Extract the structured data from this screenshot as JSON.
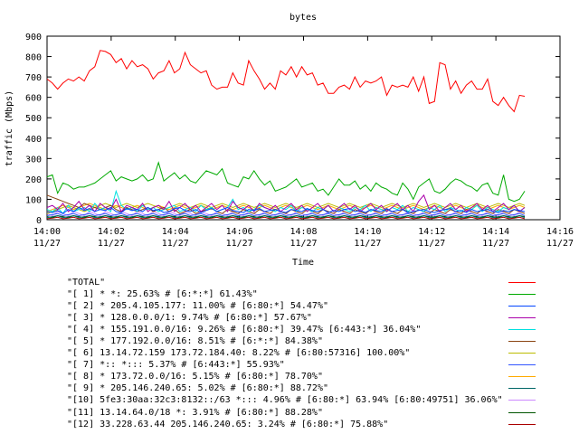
{
  "chart_data": {
    "type": "line",
    "title": "bytes",
    "xlabel": "Time",
    "ylabel": "traffic (Mbps)",
    "ylim": [
      0,
      900
    ],
    "xlim": [
      "14:00",
      "14:16"
    ],
    "y_ticks": [
      "0",
      "100",
      "200",
      "300",
      "400",
      "500",
      "600",
      "700",
      "800",
      "900"
    ],
    "x_ticks": [
      {
        "time": "14:00",
        "date": "11/27"
      },
      {
        "time": "14:02",
        "date": "11/27"
      },
      {
        "time": "14:04",
        "date": "11/27"
      },
      {
        "time": "14:06",
        "date": "11/27"
      },
      {
        "time": "14:08",
        "date": "11/27"
      },
      {
        "time": "14:10",
        "date": "11/27"
      },
      {
        "time": "14:12",
        "date": "11/27"
      },
      {
        "time": "14:14",
        "date": "11/27"
      },
      {
        "time": "14:16",
        "date": "11/27"
      }
    ],
    "grid": false,
    "legend_position": "bottom",
    "series": [
      {
        "name": "\"TOTAL\"",
        "color": "#ff0000",
        "values": [
          690,
          670,
          640,
          670,
          690,
          680,
          700,
          680,
          730,
          750,
          830,
          825,
          810,
          770,
          790,
          740,
          780,
          750,
          760,
          740,
          690,
          720,
          730,
          780,
          720,
          740,
          820,
          760,
          740,
          720,
          730,
          660,
          640,
          650,
          650,
          720,
          670,
          660,
          780,
          730,
          690,
          640,
          670,
          640,
          730,
          710,
          750,
          700,
          750,
          710,
          720,
          660,
          670,
          620,
          620,
          650,
          660,
          640,
          700,
          650,
          680,
          670,
          680,
          700,
          610,
          660,
          650,
          660,
          650,
          700,
          630,
          700,
          570,
          580,
          770,
          760,
          640,
          680,
          620,
          660,
          680,
          640,
          640,
          690,
          580,
          560,
          600,
          560,
          530,
          610,
          605
        ]
      },
      {
        "name": "\"[ 1] * *: 25.63% # [6:*:*] 61.43%\"",
        "color": "#00aa00",
        "values": [
          210,
          220,
          130,
          180,
          170,
          150,
          160,
          160,
          170,
          180,
          200,
          220,
          240,
          190,
          210,
          200,
          190,
          200,
          220,
          190,
          200,
          280,
          190,
          210,
          230,
          200,
          220,
          190,
          180,
          210,
          240,
          230,
          220,
          250,
          180,
          170,
          160,
          210,
          200,
          240,
          200,
          170,
          190,
          140,
          150,
          160,
          180,
          200,
          160,
          170,
          180,
          140,
          150,
          120,
          160,
          200,
          170,
          170,
          190,
          150,
          170,
          140,
          180,
          160,
          150,
          130,
          120,
          180,
          150,
          100,
          160,
          180,
          200,
          140,
          130,
          150,
          180,
          200,
          190,
          170,
          160,
          140,
          170,
          180,
          130,
          120,
          220,
          100,
          90,
          100,
          140
        ]
      },
      {
        "name": "\"[ 2] * 205.4.105.177: 11.00% # [6:80:*] 54.47%\"",
        "color": "#0044ff",
        "values": [
          40,
          35,
          45,
          30,
          50,
          40,
          60,
          45,
          55,
          40,
          50,
          45,
          60,
          40,
          35,
          55,
          45,
          50,
          40,
          60,
          45,
          50,
          35,
          40,
          55,
          60,
          45,
          40,
          50,
          35,
          45,
          55,
          40,
          50,
          60,
          45,
          40,
          35,
          50,
          45,
          55,
          40,
          45,
          50,
          40,
          35,
          50,
          45,
          40,
          55,
          45,
          40,
          50,
          35,
          45,
          40,
          50,
          55,
          40,
          45,
          35,
          50,
          45,
          40,
          55,
          40,
          45,
          50,
          35,
          40,
          45,
          50,
          40,
          35,
          45,
          50,
          55,
          40,
          45,
          35,
          50,
          40,
          45,
          50,
          40,
          35,
          45,
          40,
          50,
          45,
          40
        ]
      },
      {
        "name": "\"[ 3] * 128.0.0.0/1: 9.74% # [6:80:*] 57.67%\"",
        "color": "#aa00aa",
        "values": [
          60,
          70,
          50,
          80,
          40,
          60,
          90,
          50,
          70,
          40,
          80,
          60,
          50,
          100,
          40,
          70,
          60,
          50,
          80,
          40,
          60,
          70,
          50,
          90,
          40,
          60,
          80,
          50,
          70,
          40,
          60,
          80,
          50,
          70,
          40,
          90,
          60,
          50,
          70,
          40,
          80,
          60,
          50,
          70,
          40,
          60,
          80,
          50,
          70,
          40,
          60,
          80,
          50,
          70,
          40,
          60,
          80,
          50,
          70,
          40,
          60,
          80,
          50,
          70,
          40,
          60,
          80,
          50,
          70,
          40,
          90,
          120,
          50,
          70,
          40,
          60,
          80,
          50,
          70,
          40,
          60,
          80,
          50,
          70,
          40,
          60,
          80,
          50,
          70,
          40,
          60
        ]
      },
      {
        "name": "\"[ 4] * 155.191.0.0/16: 9.26% # [6:80:*] 39.47% [6:443:*] 36.04%\"",
        "color": "#00e0e0",
        "values": [
          50,
          40,
          60,
          30,
          70,
          40,
          50,
          60,
          40,
          80,
          50,
          60,
          40,
          140,
          70,
          50,
          60,
          40,
          70,
          50,
          60,
          40,
          50,
          60,
          70,
          40,
          50,
          60,
          40,
          70,
          50,
          60,
          40,
          50,
          60,
          100,
          50,
          60,
          40,
          50,
          70,
          60,
          50,
          40,
          60,
          50,
          70,
          40,
          60,
          50,
          40,
          60,
          50,
          70,
          40,
          60,
          50,
          40,
          60,
          50,
          70,
          40,
          60,
          50,
          40,
          60,
          50,
          70,
          40,
          60,
          50,
          40,
          60,
          50,
          70,
          40,
          60,
          50,
          40,
          60,
          50,
          70,
          40,
          60,
          50,
          40,
          60,
          50,
          70,
          40,
          60
        ]
      },
      {
        "name": "\"[ 5] * 177.192.0.0/16: 8.51% # [6:*:*] 84.38%\"",
        "color": "#8b4513",
        "values": [
          120,
          110,
          100,
          90,
          80,
          70,
          60,
          80,
          70,
          60,
          50,
          60,
          70,
          50,
          40,
          60,
          50,
          40,
          50,
          60,
          40,
          50,
          60,
          40,
          50,
          30,
          40,
          50,
          30,
          40,
          50,
          60,
          40,
          30,
          50,
          40,
          30,
          50,
          40,
          30,
          50,
          40,
          30,
          50,
          40,
          30,
          50,
          40,
          30,
          50,
          40,
          30,
          50,
          40,
          30,
          50,
          40,
          30,
          50,
          40,
          30,
          50,
          40,
          30,
          50,
          40,
          30,
          50,
          40,
          30,
          50,
          40,
          30,
          50,
          40,
          30,
          50,
          40,
          30,
          50,
          40,
          30,
          50,
          40,
          30,
          50,
          40,
          30,
          50,
          40,
          30
        ]
      },
      {
        "name": "\"[ 6] 13.14.72.159 173.72.184.40: 8.22% # [6:80:57316] 100.00%\"",
        "color": "#bbbb00",
        "values": [
          30,
          40,
          50,
          60,
          70,
          60,
          50,
          40,
          50,
          60,
          70,
          80,
          70,
          60,
          70,
          80,
          70,
          60,
          70,
          80,
          70,
          60,
          50,
          60,
          70,
          80,
          70,
          60,
          70,
          80,
          70,
          60,
          70,
          80,
          70,
          60,
          70,
          80,
          70,
          60,
          70,
          80,
          70,
          60,
          70,
          80,
          70,
          60,
          70,
          80,
          70,
          60,
          70,
          80,
          70,
          60,
          70,
          80,
          70,
          60,
          70,
          80,
          70,
          60,
          70,
          80,
          70,
          60,
          70,
          80,
          70,
          60,
          70,
          80,
          70,
          60,
          70,
          80,
          70,
          60,
          70,
          80,
          70,
          60,
          70,
          80,
          70,
          60,
          70,
          80,
          70
        ]
      },
      {
        "name": "\"[ 7] *:: *::: 5.37% # [6:443:*] 55.93%\"",
        "color": "#3355ff",
        "values": [
          20,
          25,
          30,
          20,
          25,
          30,
          20,
          25,
          30,
          20,
          25,
          30,
          20,
          25,
          30,
          20,
          25,
          30,
          20,
          25,
          30,
          20,
          25,
          30,
          20,
          25,
          30,
          20,
          25,
          30,
          20,
          25,
          30,
          20,
          25,
          30,
          20,
          25,
          30,
          20,
          25,
          30,
          20,
          25,
          30,
          20,
          25,
          30,
          20,
          25,
          30,
          20,
          25,
          30,
          20,
          25,
          30,
          20,
          25,
          30,
          20,
          25,
          30,
          20,
          25,
          30,
          20,
          25,
          30,
          20,
          25,
          30,
          20,
          25,
          30,
          20,
          25,
          30,
          20,
          25,
          30,
          20,
          25,
          30,
          20,
          25,
          30,
          20,
          25,
          30,
          20
        ]
      },
      {
        "name": "\"[ 8] * 173.72.0.0/16: 5.15% # [6:80:*] 78.70%\"",
        "color": "#ffaa00",
        "values": [
          40,
          50,
          60,
          70,
          60,
          50,
          60,
          70,
          80,
          70,
          60,
          50,
          60,
          70,
          60,
          50,
          60,
          70,
          60,
          50,
          60,
          70,
          60,
          50,
          60,
          70,
          60,
          50,
          60,
          70,
          60,
          50,
          60,
          70,
          60,
          50,
          60,
          70,
          60,
          50,
          60,
          70,
          60,
          50,
          60,
          70,
          60,
          50,
          60,
          70,
          60,
          50,
          60,
          70,
          60,
          50,
          60,
          70,
          60,
          50,
          60,
          70,
          60,
          50,
          60,
          70,
          60,
          50,
          60,
          70,
          60,
          50,
          60,
          70,
          60,
          50,
          60,
          70,
          60,
          50,
          60,
          70,
          60,
          50,
          60,
          70,
          60,
          50,
          60,
          70,
          60
        ]
      },
      {
        "name": "\"[ 9] * 205.146.240.65: 5.02% # [6:80:*] 88.72%\"",
        "color": "#006666",
        "values": [
          10,
          15,
          20,
          10,
          15,
          20,
          10,
          15,
          20,
          10,
          15,
          20,
          10,
          15,
          20,
          10,
          15,
          20,
          10,
          15,
          20,
          10,
          15,
          20,
          10,
          15,
          20,
          10,
          15,
          20,
          10,
          15,
          20,
          10,
          15,
          20,
          10,
          15,
          20,
          10,
          15,
          20,
          10,
          15,
          20,
          10,
          15,
          20,
          10,
          15,
          20,
          10,
          15,
          20,
          10,
          15,
          20,
          10,
          15,
          20,
          10,
          15,
          20,
          10,
          15,
          20,
          10,
          15,
          20,
          10,
          15,
          20,
          10,
          15,
          20,
          10,
          15,
          20,
          10,
          15,
          20,
          10,
          15,
          20,
          10,
          15,
          20,
          10,
          15,
          20,
          10
        ]
      },
      {
        "name": "\"[10] 5fe3:30aa:32c3:8132::/63 *::: 4.96% # [6:80:*] 63.94% [6:80:49751] 36.06%\"",
        "color": "#cc88ff",
        "values": [
          30,
          20,
          40,
          30,
          20,
          40,
          30,
          20,
          40,
          30,
          20,
          40,
          30,
          20,
          40,
          30,
          20,
          40,
          30,
          20,
          40,
          30,
          20,
          40,
          30,
          20,
          40,
          30,
          20,
          40,
          30,
          20,
          40,
          30,
          20,
          40,
          30,
          20,
          40,
          30,
          20,
          40,
          30,
          20,
          40,
          30,
          20,
          40,
          30,
          20,
          40,
          30,
          20,
          40,
          30,
          20,
          40,
          30,
          20,
          40,
          30,
          20,
          40,
          30,
          20,
          40,
          30,
          20,
          40,
          30,
          20,
          40,
          30,
          20,
          40,
          30,
          20,
          40,
          30,
          20,
          40,
          30,
          20,
          40,
          30,
          20,
          40,
          30,
          20,
          40,
          30
        ]
      },
      {
        "name": "\"[11] 13.14.64.0/18 *: 3.91% # [6:80:*] 88.28%\"",
        "color": "#005500",
        "values": [
          15,
          10,
          20,
          15,
          10,
          20,
          15,
          10,
          20,
          15,
          10,
          20,
          15,
          10,
          20,
          15,
          10,
          20,
          15,
          10,
          20,
          15,
          10,
          20,
          15,
          10,
          20,
          15,
          10,
          20,
          15,
          10,
          20,
          15,
          10,
          20,
          15,
          10,
          20,
          15,
          10,
          20,
          15,
          10,
          20,
          15,
          10,
          20,
          15,
          10,
          20,
          15,
          10,
          20,
          15,
          10,
          20,
          15,
          10,
          20,
          15,
          10,
          20,
          15,
          10,
          20,
          15,
          10,
          20,
          15,
          10,
          20,
          15,
          10,
          20,
          15,
          10,
          20,
          15,
          10,
          20,
          15,
          10,
          20,
          15,
          10,
          20,
          15,
          10,
          20,
          15
        ]
      },
      {
        "name": "\"[12] 33.228.63.44 205.146.240.65: 3.24% # [6:80:*] 75.88%\"",
        "color": "#aa0000",
        "values": [
          5,
          8,
          12,
          5,
          8,
          12,
          5,
          8,
          12,
          5,
          8,
          12,
          5,
          8,
          12,
          5,
          8,
          12,
          5,
          8,
          12,
          5,
          8,
          12,
          5,
          8,
          12,
          5,
          8,
          12,
          5,
          8,
          12,
          5,
          8,
          12,
          5,
          8,
          12,
          5,
          8,
          12,
          5,
          8,
          12,
          5,
          8,
          12,
          5,
          8,
          12,
          5,
          8,
          12,
          5,
          8,
          12,
          5,
          8,
          12,
          5,
          8,
          12,
          5,
          8,
          12,
          5,
          8,
          12,
          5,
          8,
          12,
          5,
          8,
          12,
          5,
          8,
          12,
          5,
          8,
          12,
          5,
          8,
          12,
          5,
          8,
          12,
          5,
          8,
          12,
          5
        ]
      }
    ]
  }
}
